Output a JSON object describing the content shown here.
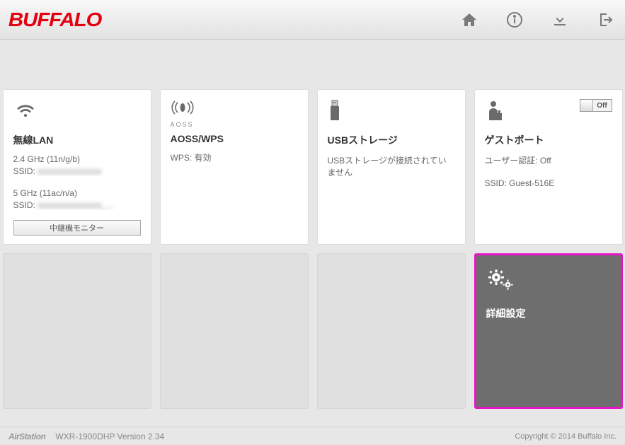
{
  "brand": "BUFFALO",
  "cards": {
    "wlan": {
      "title": "無線LAN",
      "band24": "2.4 GHz (11n/g/b)",
      "ssid24_label": "SSID: ",
      "ssid24_value": "xxxxxxxxxxxxxxx",
      "band5": "5 GHz (11ac/n/a)",
      "ssid5_label": "SSID: ",
      "ssid5_value": "xxxxxxxxxxxxxxx_...",
      "repeater_btn": "中継機モニター"
    },
    "aoss": {
      "icon_label": "AOSS",
      "title": "AOSS/WPS",
      "wps": "WPS: 有効"
    },
    "usb": {
      "title": "USBストレージ",
      "status": "USBストレージが接続されていません"
    },
    "guest": {
      "toggle": "Off",
      "title": "ゲストポート",
      "auth": "ユーザー認証: Off",
      "ssid": "SSID: Guest-516E"
    },
    "advanced": {
      "title": "詳細設定"
    }
  },
  "footer": {
    "airstation": "AirStation",
    "model": "WXR-1900DHP   Version 2.34",
    "copyright": "Copyright © 2014 Buffalo Inc."
  }
}
